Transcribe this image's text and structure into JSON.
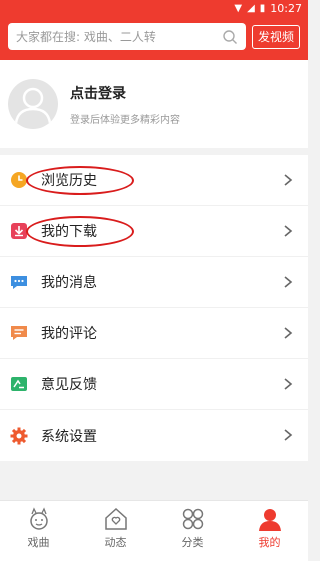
{
  "status_bar": {
    "time": "10:27"
  },
  "search": {
    "placeholder": "大家都在搜: 戏曲、二人转",
    "post_button": "发视频"
  },
  "profile": {
    "title": "点击登录",
    "subtitle": "登录后体验更多精彩内容"
  },
  "menu": {
    "items": [
      {
        "label": "浏览历史",
        "icon": "clock-icon",
        "color": "#f5a623"
      },
      {
        "label": "我的下载",
        "icon": "download-icon",
        "color": "#e8415a"
      },
      {
        "label": "我的消息",
        "icon": "message-icon",
        "color": "#3d8fe0"
      },
      {
        "label": "我的评论",
        "icon": "comment-icon",
        "color": "#f08a4b"
      },
      {
        "label": "意见反馈",
        "icon": "feedback-icon",
        "color": "#2db36b"
      },
      {
        "label": "系统设置",
        "icon": "gear-icon",
        "color": "#ee5a2f"
      }
    ]
  },
  "tabs": [
    {
      "label": "戏曲",
      "icon": "opera-icon"
    },
    {
      "label": "动态",
      "icon": "home-icon"
    },
    {
      "label": "分类",
      "icon": "category-icon"
    },
    {
      "label": "我的",
      "icon": "user-icon",
      "active": true
    }
  ],
  "colors": {
    "brand": "#ee3b2f",
    "annotation": "#d91c1c"
  }
}
